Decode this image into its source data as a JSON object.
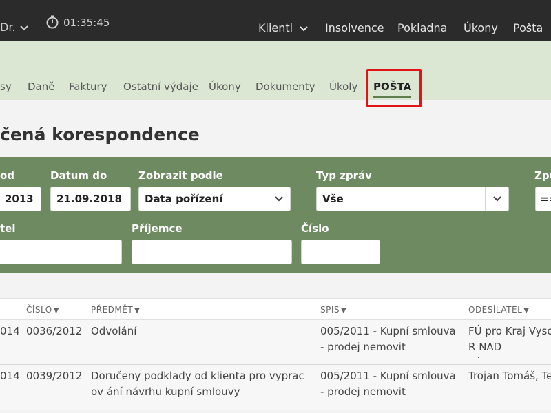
{
  "topbar": {
    "user_fragment": "Dr.",
    "timer": "01:35:45",
    "nav": [
      "Klienti",
      "Insolvence",
      "Pokladna",
      "Úkony",
      "Pošta"
    ]
  },
  "tabs": [
    "sy",
    "Daně",
    "Faktury",
    "Ostatní výdaje",
    "Úkony",
    "Dokumenty",
    "Úkoly",
    "POŠTA"
  ],
  "page_title": "čená korespondence",
  "filters": {
    "date_from_label": "od",
    "date_from_value": "2013",
    "date_to_label": "Datum do",
    "date_to_value": "21.09.2018",
    "show_by_label": "Zobrazit podle",
    "show_by_value": "Data pořízení",
    "msg_type_label": "Typ zpráv",
    "msg_type_value": "Vše",
    "method_label": "Způ",
    "method_value": "==",
    "sender_label": "tel",
    "recipient_label": "Příjemce",
    "number_label": "Číslo"
  },
  "table": {
    "headers": [
      "ČÍSLO",
      "PŘEDMĚT",
      "SPIS",
      "ODESÍLATEL"
    ],
    "rows": [
      {
        "date_fragment": "014",
        "number": "0036/2012",
        "subject": "Odvolání",
        "file": "005/2011 - Kupní smlouva - prodej nemovit",
        "sender": "FÚ pro Kraj Vyso R NAD SÁZAVOU"
      },
      {
        "date_fragment": "014",
        "number": "0039/2012",
        "subject": "Doručeny podklady od klienta pro vypracov ání návrhu kupní smlouvy",
        "file": "005/2011 - Kupní smlouva - prodej nemovit",
        "sender": "Trojan Tomáš, Te"
      }
    ]
  },
  "colors": {
    "topbar": "#2b2b2b",
    "subband": "#dbe7d3",
    "filter_panel": "#6d8a61",
    "highlight": "#e01414"
  }
}
